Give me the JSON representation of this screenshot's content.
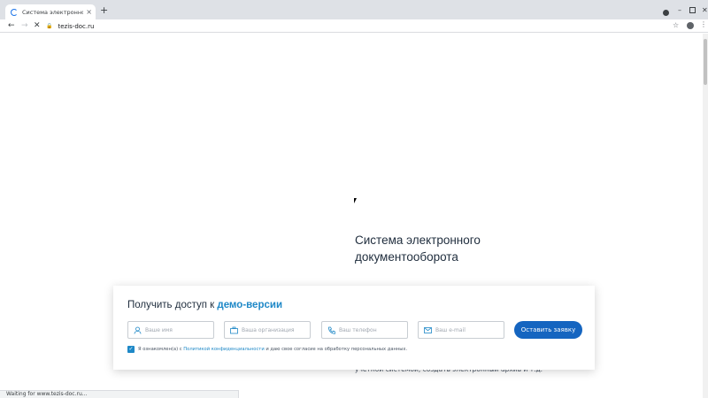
{
  "browser": {
    "tab_title": "Система электронного до",
    "tab_close": "×",
    "new_tab": "+",
    "url": "tezis-doc.ru",
    "status_text": "Waiting for www.tezis-doc.ru..."
  },
  "hero": {
    "title": "Система электронного документооборота",
    "partial_text": "",
    "text_tail": "учетной системой, создать электронный архив и т.д."
  },
  "demo_form": {
    "title_prefix": "Получить доступ к ",
    "title_highlight": "демо-версии",
    "fields": [
      {
        "placeholder": "Ваше имя",
        "icon": "user-icon"
      },
      {
        "placeholder": "Ваша организация",
        "icon": "briefcase-icon"
      },
      {
        "placeholder": "Ваш телефон",
        "icon": "phone-icon"
      },
      {
        "placeholder": "Ваш e-mail",
        "icon": "mail-icon"
      }
    ],
    "submit_label": "Оставить заявку",
    "consent": {
      "checked": true,
      "before": "Я ознакомлен(а) с ",
      "link": "Политикой конфиденциальности",
      "after": " и даю свое согласие на обработку персональных данных."
    }
  },
  "colors": {
    "accent": "#1e88c7",
    "button": "#1565c0"
  }
}
